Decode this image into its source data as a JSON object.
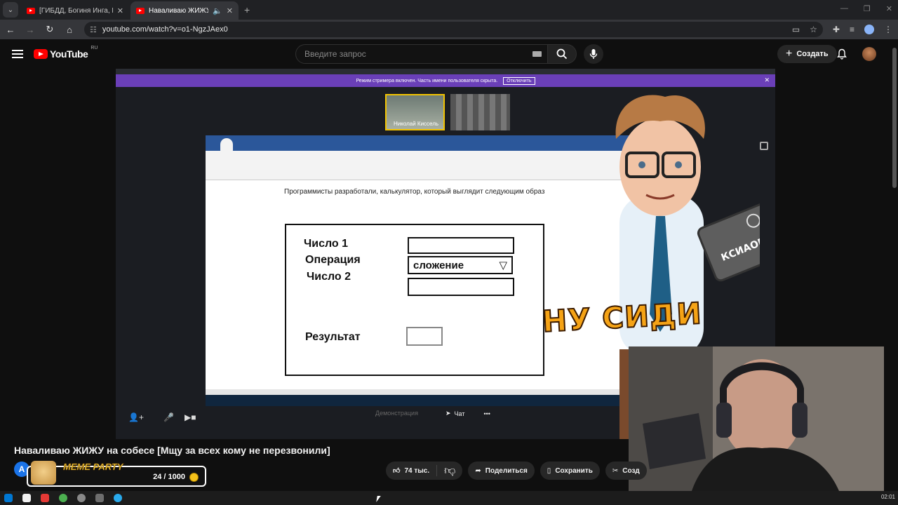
{
  "browser": {
    "tabs": [
      {
        "title": "[ГИБДД, Богиня Инга, Полная",
        "active": false
      },
      {
        "title": "Наваливаю ЖИЖУ на собе",
        "active": true
      }
    ],
    "new_tab": "+",
    "url": "youtube.com/watch?v=o1-NgzJAex0"
  },
  "youtube": {
    "logo_text": "YouTube",
    "region": "RU",
    "search_placeholder": "Введите запрос",
    "create_label": "Создать"
  },
  "meeting": {
    "streamer_banner": "Режим стримера включен. Часть имени пользователя скрыта.",
    "banner_button": "Отключить",
    "participant_name": "Николай Киссель",
    "chat_label": "Чат",
    "demo_label": "Демонстрация",
    "more_label": "•••"
  },
  "document": {
    "intro": "Программисты разработали, калькулятор, который выглядит следующим образ",
    "label_num1": "Число 1",
    "label_op": "Операция",
    "label_num2": "Число 2",
    "label_result": "Результат",
    "op_value": "сложение",
    "op_arrow": "▽"
  },
  "overlay": {
    "sticker_text": "НУ СИДИ",
    "laptop_text": "КСИАОМИ"
  },
  "video": {
    "title": "Наваливаю ЖИЖУ на собесе [Мщу за всех кому не перезвонили]"
  },
  "actions": {
    "likes": "74 тыс.",
    "share": "Поделиться",
    "save": "Сохранить",
    "clip": "Созд"
  },
  "channel": {
    "avatar_letter": "A"
  },
  "meme_party": {
    "title": "MEME PARTY",
    "count": "24 / 1000"
  },
  "taskbar": {
    "clock": "02:01"
  }
}
